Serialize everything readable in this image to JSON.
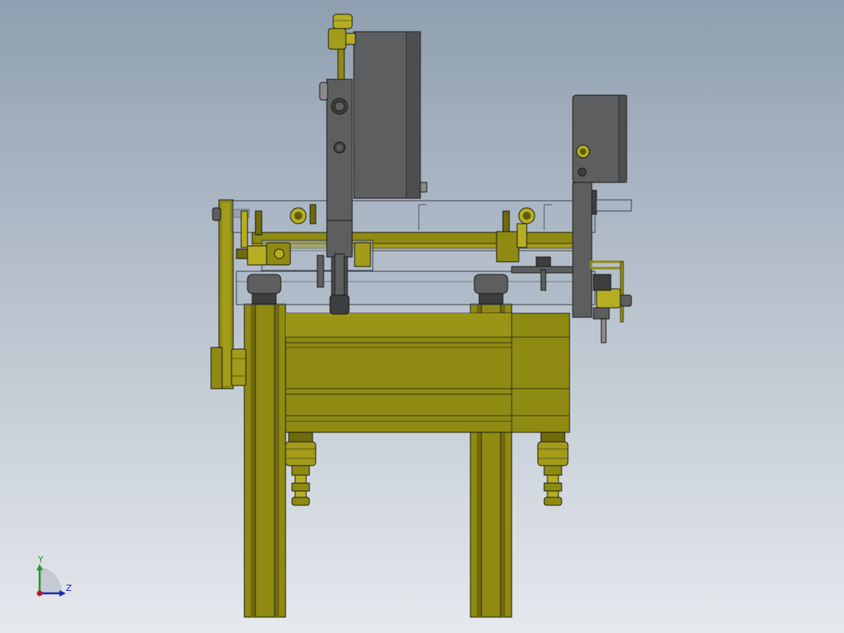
{
  "viewport": {
    "background_top": "#8f9fb1",
    "background_bottom": "#e6e9ed"
  },
  "colors": {
    "olive": "#8f8a12",
    "olive_light": "#b5ae23",
    "olive_dark": "#5e5a08",
    "steel": "#5d5e60",
    "steel_dark": "#3d3e40",
    "steel_light": "#8a8b8e",
    "glass": "#a9b6c5",
    "edge": "#1c1c12"
  },
  "triad": {
    "y_label": "Y",
    "z_label": "Z",
    "y_color": "#1a9c1a",
    "z_color": "#1a2aa6",
    "origin_color": "#c0121a"
  }
}
